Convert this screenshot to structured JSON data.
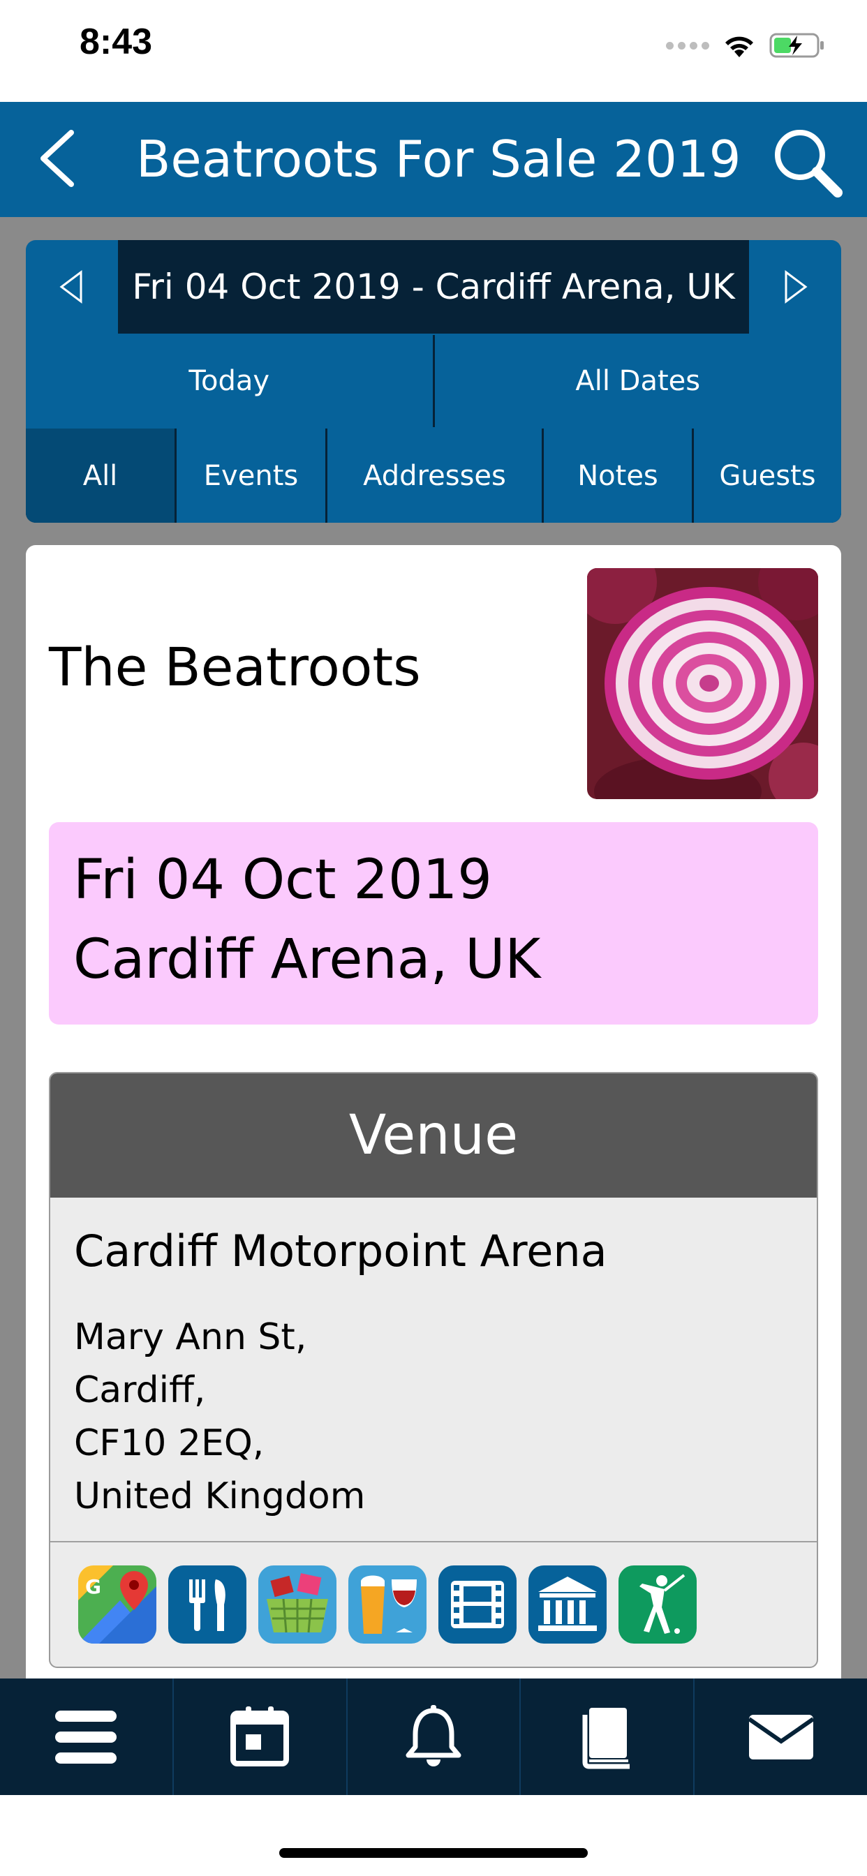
{
  "status_bar": {
    "time": "8:43"
  },
  "header": {
    "title": "Beatroots For Sale 2019",
    "back_icon": "chevron-left-icon",
    "search_icon": "search-icon",
    "color": "#06629a"
  },
  "date_nav": {
    "current": "Fri 04 Oct 2019 - Cardiff Arena, UK",
    "today_label": "Today",
    "all_dates_label": "All Dates",
    "filters": [
      "All",
      "Events",
      "Addresses",
      "Notes",
      "Guests"
    ],
    "active_filter": "All"
  },
  "event": {
    "band_name": "The Beatroots",
    "date_line": "Fri 04 Oct 2019",
    "location_line": "Cardiff Arena, UK",
    "highlight_color": "#fbcafd"
  },
  "venue": {
    "header": "Venue",
    "name": "Cardiff Motorpoint Arena",
    "address_lines": [
      "Mary Ann St,",
      "Cardiff,",
      "CF10 2EQ,",
      "United Kingdom"
    ],
    "icons": [
      "google-maps-icon",
      "restaurant-icon",
      "shopping-basket-icon",
      "drinks-icon",
      "film-icon",
      "museum-icon",
      "golf-icon"
    ]
  },
  "tab_bar": {
    "tabs": [
      "menu-icon",
      "calendar-icon",
      "bell-icon",
      "book-icon",
      "mail-icon"
    ],
    "color": "#062237"
  }
}
